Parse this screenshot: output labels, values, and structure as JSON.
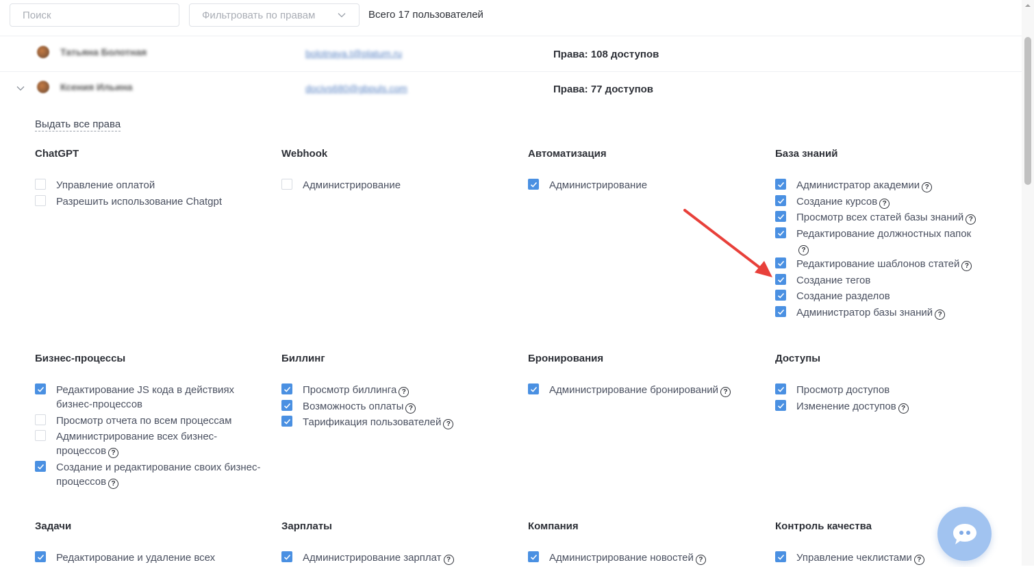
{
  "toolbar": {
    "search_placeholder": "Поиск",
    "filter_placeholder": "Фильтровать по правам",
    "total_users": "Всего 17 пользователей"
  },
  "users": [
    {
      "name": "Татьяна Болотная",
      "email": "bolotnaya.t@platum.ru",
      "rights_label": "Права:",
      "rights_count": "108 доступов"
    },
    {
      "name": "Ксения Ильина",
      "email": "docivs680@gbpuls.com",
      "rights_label": "Права:",
      "rights_count": "77 доступов"
    }
  ],
  "grant_all": "Выдать все права",
  "groups": [
    {
      "title": "ChatGPT",
      "perms": [
        {
          "label": "Управление оплатой",
          "checked": false,
          "help": false
        },
        {
          "label": "Разрешить использование Chatgpt",
          "checked": false,
          "help": false
        }
      ]
    },
    {
      "title": "Webhook",
      "perms": [
        {
          "label": "Администрирование",
          "checked": false,
          "help": false
        }
      ]
    },
    {
      "title": "Автоматизация",
      "perms": [
        {
          "label": "Администрирование",
          "checked": true,
          "help": false
        }
      ]
    },
    {
      "title": "База знаний",
      "perms": [
        {
          "label": "Администратор академии",
          "checked": true,
          "help": true
        },
        {
          "label": "Создание курсов",
          "checked": true,
          "help": true
        },
        {
          "label": "Просмотр всех статей базы знаний",
          "checked": true,
          "help": true
        },
        {
          "label": "Редактирование должностных папок",
          "checked": true,
          "help": true
        },
        {
          "label": "Редактирование шаблонов статей",
          "checked": true,
          "help": true
        },
        {
          "label": "Создание тегов",
          "checked": true,
          "help": false
        },
        {
          "label": "Создание разделов",
          "checked": true,
          "help": false
        },
        {
          "label": "Администратор базы знаний",
          "checked": true,
          "help": true
        }
      ]
    },
    {
      "title": "Бизнес-процессы",
      "perms": [
        {
          "label": "Редактирование JS кода в действиях бизнес-процессов",
          "checked": true,
          "help": false
        },
        {
          "label": "Просмотр отчета по всем процессам",
          "checked": false,
          "help": false
        },
        {
          "label": "Администрирование всех бизнес-процессов",
          "checked": false,
          "help": true
        },
        {
          "label": "Создание и редактирование своих бизнес-процессов",
          "checked": true,
          "help": true
        }
      ]
    },
    {
      "title": "Биллинг",
      "perms": [
        {
          "label": "Просмотр биллинга",
          "checked": true,
          "help": true
        },
        {
          "label": "Возможность оплаты",
          "checked": true,
          "help": true
        },
        {
          "label": "Тарификация пользователей",
          "checked": true,
          "help": true
        }
      ]
    },
    {
      "title": "Бронирования",
      "perms": [
        {
          "label": "Администрирование бронирований",
          "checked": true,
          "help": true
        }
      ]
    },
    {
      "title": "Доступы",
      "perms": [
        {
          "label": "Просмотр доступов",
          "checked": true,
          "help": false
        },
        {
          "label": "Изменение доступов",
          "checked": true,
          "help": true
        }
      ]
    },
    {
      "title": "Задачи",
      "perms": [
        {
          "label": "Редактирование и удаление всех",
          "checked": true,
          "help": false
        }
      ]
    },
    {
      "title": "Зарплаты",
      "perms": [
        {
          "label": "Администрирование зарплат",
          "checked": true,
          "help": true
        }
      ]
    },
    {
      "title": "Компания",
      "perms": [
        {
          "label": "Администрирование новостей",
          "checked": true,
          "help": true
        }
      ]
    },
    {
      "title": "Контроль качества",
      "perms": [
        {
          "label": "Управление чеклистами",
          "checked": true,
          "help": true
        }
      ]
    }
  ],
  "colors": {
    "accent": "#4a90e2",
    "annotation_arrow": "#e8403a"
  },
  "icons": {
    "chat": "chat-bubble-icon",
    "help": "question-circle-icon"
  }
}
